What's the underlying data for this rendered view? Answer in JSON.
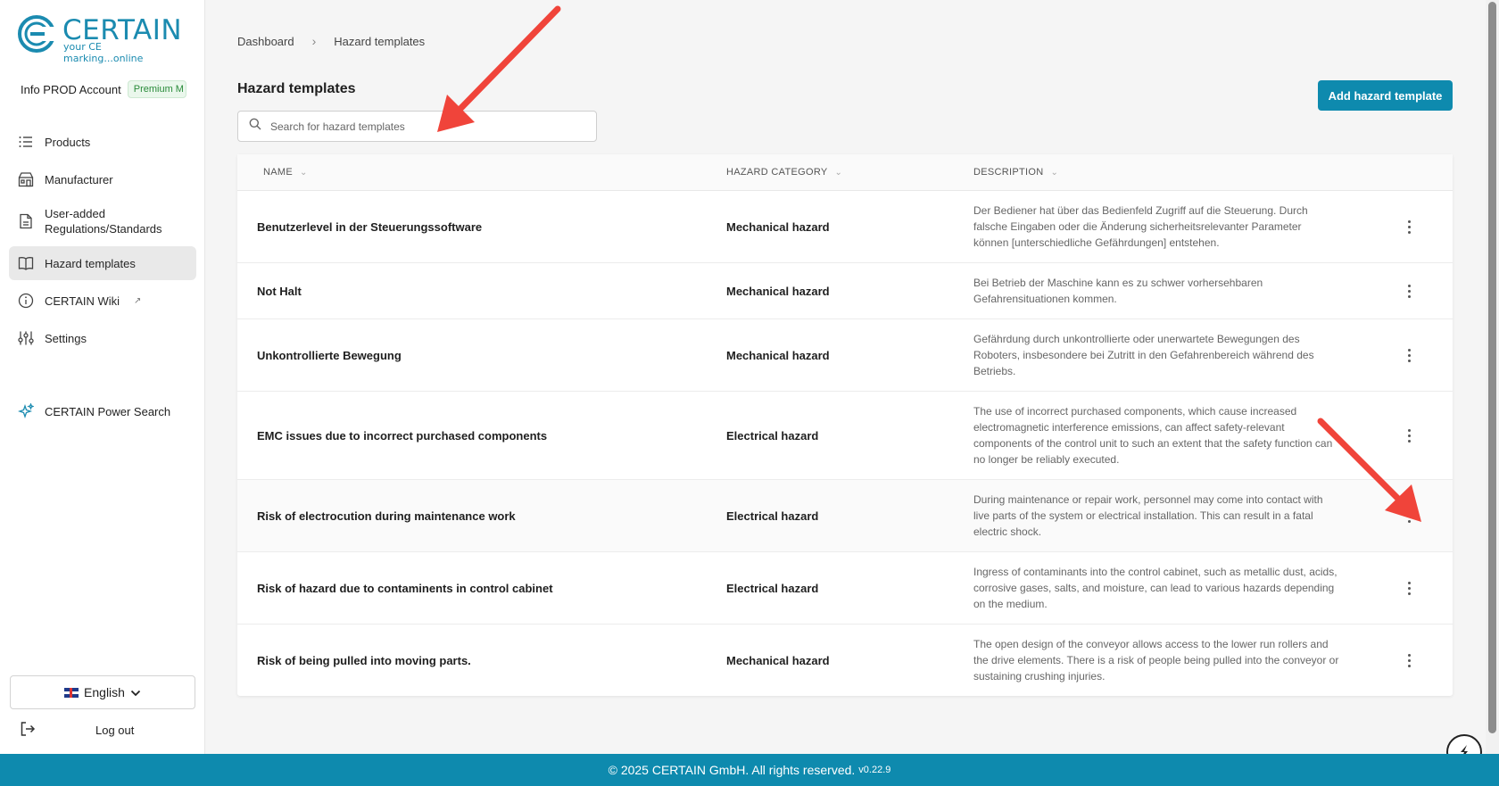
{
  "brand": {
    "logo_word": "CERTAIN",
    "logo_tagline": "your CE marking...online",
    "accent": "#0e8aae"
  },
  "account": {
    "name": "Info PROD Account",
    "plan_badge": "Premium M"
  },
  "sidebar": {
    "items": [
      {
        "label": "Products",
        "icon": "list-icon"
      },
      {
        "label": "Manufacturer",
        "icon": "factory-icon"
      },
      {
        "label": "User-added Regulations/Standards",
        "icon": "document-icon"
      },
      {
        "label": "Hazard templates",
        "icon": "book-icon",
        "active": true
      },
      {
        "label": "CERTAIN Wiki",
        "icon": "info-icon"
      },
      {
        "label": "Settings",
        "icon": "sliders-icon"
      }
    ],
    "power_search": "CERTAIN Power Search",
    "language": "English",
    "logout": "Log out"
  },
  "breadcrumb": {
    "home": "Dashboard",
    "current": "Hazard templates"
  },
  "page": {
    "title": "Hazard templates",
    "search_placeholder": "Search for hazard templates",
    "add_button": "Add hazard template"
  },
  "table": {
    "headers": {
      "name": "NAME",
      "category": "HAZARD CATEGORY",
      "description": "DESCRIPTION"
    },
    "rows": [
      {
        "name": "Benutzerlevel in der Steuerungssoftware",
        "category": "Mechanical hazard",
        "description": "Der Bediener hat über das Bedienfeld Zugriff auf die Steuerung. Durch falsche Eingaben oder die Änderung sicherheitsrelevanter Parameter können [unterschiedliche Gefährdungen] entstehen."
      },
      {
        "name": "Not Halt",
        "category": "Mechanical hazard",
        "description": "Bei Betrieb der Maschine kann es zu schwer vorhersehbaren Gefahrensituationen kommen."
      },
      {
        "name": "Unkontrollierte Bewegung",
        "category": "Mechanical hazard",
        "description": "Gefährdung durch unkontrollierte oder unerwartete Bewegungen des Roboters, insbesondere bei Zutritt in den Gefahrenbereich während des Betriebs."
      },
      {
        "name": "EMC issues due to incorrect purchased components",
        "category": "Electrical hazard",
        "description": "The use of incorrect purchased components, which cause increased electromagnetic interference emissions, can affect safety-relevant components of the control unit to such an extent that the safety function can no longer be reliably executed."
      },
      {
        "name": "Risk of electrocution during maintenance work",
        "category": "Electrical hazard",
        "description": "During maintenance or repair work, personnel may come into contact with live parts of the system or electrical installation. This can result in a fatal electric shock."
      },
      {
        "name": "Risk of hazard due to contaminents in control cabinet",
        "category": "Electrical hazard",
        "description": "Ingress of contaminants into the control cabinet, such as metallic dust, acids, corrosive gases, salts, and moisture, can lead to various hazards depending on the medium."
      },
      {
        "name": "Risk of being pulled into moving parts.",
        "category": "Mechanical hazard",
        "description": "The open design of the conveyor allows access to the lower run rollers and the drive elements. There is a risk of people being pulled into the conveyor or sustaining crushing injuries."
      }
    ]
  },
  "footer": {
    "copyright": "© 2025 CERTAIN GmbH. All rights reserved.",
    "version": "v0.22.9"
  }
}
